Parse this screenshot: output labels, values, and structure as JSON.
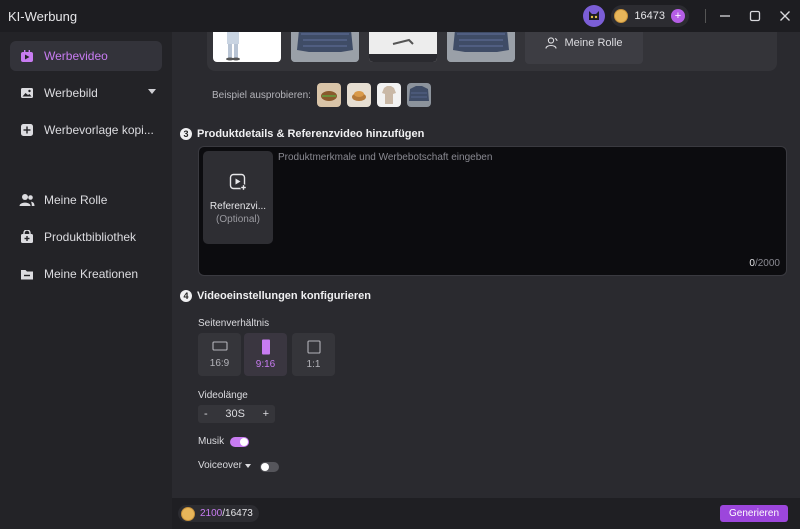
{
  "window": {
    "title": "KI-Werbung"
  },
  "account": {
    "credits": "16473"
  },
  "sidebar": {
    "items": [
      {
        "label": "Werbevideo",
        "icon": "video-ad-icon",
        "active": true
      },
      {
        "label": "Werbebild",
        "icon": "image-ad-icon",
        "has_dropdown": true
      },
      {
        "label": "Werbevorlage kopi...",
        "icon": "template-copy-icon"
      },
      {
        "label": "Meine Rolle",
        "icon": "user-group-icon"
      },
      {
        "label": "Produktbibliothek",
        "icon": "product-library-icon"
      },
      {
        "label": "Meine Kreationen",
        "icon": "creations-folder-icon"
      }
    ]
  },
  "examples": {
    "role_card_label": "Meine Rolle",
    "try_label": "Beispiel ausprobieren:"
  },
  "section3": {
    "number": "3",
    "title": "Produktdetails & Referenzvideo hinzufügen",
    "ref_label": "Referenzvi...",
    "ref_optional": "(Optional)",
    "placeholder": "Produktmerkmale und Werbebotschaft eingeben",
    "char_count": "0",
    "char_limit": "/2000"
  },
  "section4": {
    "number": "4",
    "title": "Videoeinstellungen konfigurieren",
    "aspect_label": "Seitenverhältnis",
    "aspect_options": [
      {
        "label": "16:9",
        "selected": false
      },
      {
        "label": "9:16",
        "selected": true
      },
      {
        "label": "1:1",
        "selected": false
      }
    ],
    "length_label": "Videolänge",
    "length_minus": "-",
    "length_value": "30S",
    "length_plus": "+",
    "music_label": "Musik",
    "music_on": true,
    "voiceover_label": "Voiceover",
    "voiceover_on": false
  },
  "footer": {
    "credits_used": "2100",
    "credits_total": "/16473",
    "generate_label": "Generieren"
  },
  "colors": {
    "accent": "#c87cf2",
    "button": "#9c46dc",
    "bg_main": "#2a2a2f",
    "bg_sidebar": "#232327"
  }
}
